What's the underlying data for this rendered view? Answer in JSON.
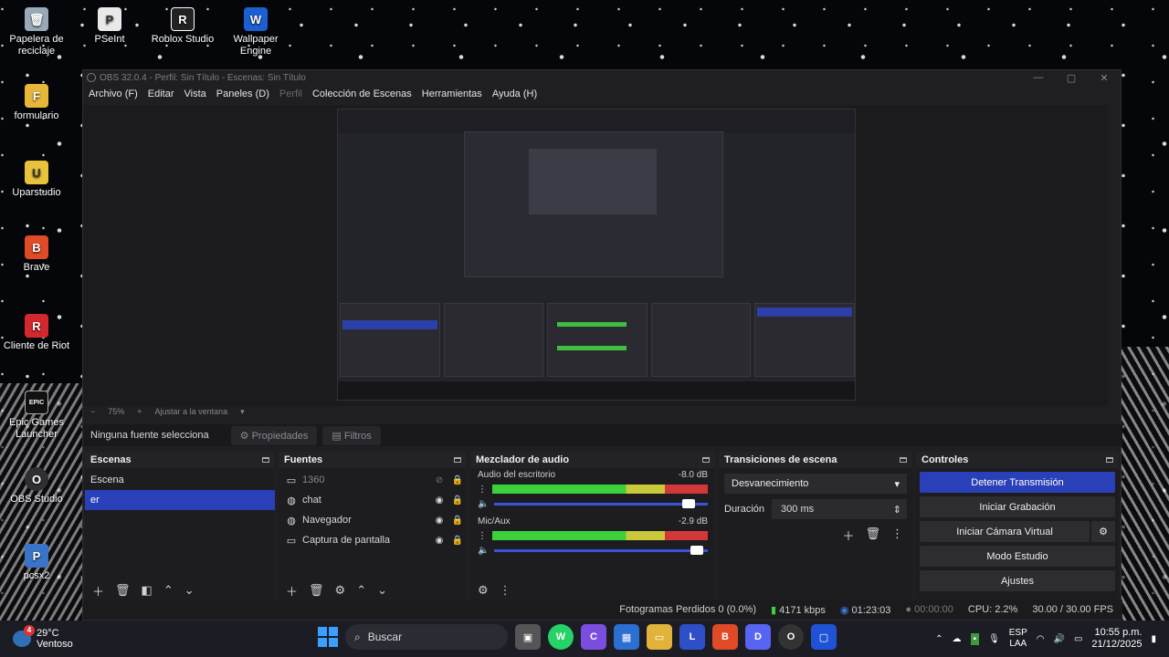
{
  "desktop": {
    "icons": [
      {
        "label": "Papelera de reciclaje",
        "glyph": "🗑"
      },
      {
        "label": "PSeInt",
        "glyph": "P"
      },
      {
        "label": "Roblox Studio",
        "glyph": "R"
      },
      {
        "label": "Wallpaper Engine",
        "glyph": "W"
      },
      {
        "label": "formulario",
        "glyph": "F"
      },
      {
        "label": "Uparstudio",
        "glyph": "U"
      },
      {
        "label": "Brave",
        "glyph": "B"
      },
      {
        "label": "Cliente de Riot",
        "glyph": "R"
      },
      {
        "label": "Epic Games Launcher",
        "glyph": "EPIC"
      },
      {
        "label": "OBS Studio",
        "glyph": "O"
      },
      {
        "label": "pcsx2",
        "glyph": "P"
      }
    ]
  },
  "window": {
    "title": "OBS 32.0.4 - Perfil: Sin Título - Escenas: Sin Título",
    "controls": {
      "minimize": "—",
      "maximize": "▢",
      "close": "✕"
    },
    "menu": [
      "Archivo (F)",
      "Editar",
      "Vista",
      "Paneles (D)",
      "Perfil",
      "Colección de Escenas",
      "Herramientas",
      "Ayuda (H)"
    ]
  },
  "zoom": {
    "minus": "−",
    "value": "75%",
    "plus": "+",
    "fit": "Ajustar a la ventana",
    "caret": "▾"
  },
  "source_bar": {
    "status": "Ninguna fuente selecciona",
    "properties": "Propiedades",
    "filters": "Filtros"
  },
  "scenes": {
    "title": "Escenas",
    "items": [
      "Escena",
      "er"
    ],
    "selected": 1
  },
  "sources": {
    "title": "Fuentes",
    "items": [
      {
        "name": "1360",
        "icon": "monitor",
        "hidden": true
      },
      {
        "name": "chat",
        "icon": "browser",
        "hidden": false
      },
      {
        "name": "Navegador",
        "icon": "browser",
        "hidden": false
      },
      {
        "name": "Captura de pantalla",
        "icon": "monitor",
        "hidden": false
      }
    ]
  },
  "mixer": {
    "title": "Mezclador de audio",
    "channels": [
      {
        "name": "Audio del escritorio",
        "db": "-8.0 dB",
        "volume": 0.9
      },
      {
        "name": "Mic/Aux",
        "db": "-2.9 dB",
        "volume": 0.98
      }
    ],
    "scale": [
      "-60",
      "-55",
      "-50",
      "-45",
      "-40",
      "-35",
      "-30",
      "-25",
      "-20",
      "-15",
      "-10",
      "-5",
      "0"
    ]
  },
  "transitions": {
    "title": "Transiciones de escena",
    "selected": "Desvanecimiento",
    "duration_label": "Duración",
    "duration_value": "300 ms"
  },
  "controls": {
    "title": "Controles",
    "stop_stream": "Detener Transmisión",
    "start_recording": "Iniciar Grabación",
    "start_virtual_cam": "Iniciar Cámara Virtual",
    "studio_mode": "Modo Estudio",
    "settings": "Ajustes"
  },
  "status": {
    "dropped": "Fotogramas Perdidos 0 (0.0%)",
    "bitrate": "4171 kbps",
    "live_time": "01:23:03",
    "rec_time": "00:00:00",
    "cpu": "CPU: 2.2%",
    "fps": "30.00 / 30.00 FPS"
  },
  "taskbar": {
    "temp": "29°C",
    "weather": "Ventoso",
    "weather_badge": "4",
    "search": "Buscar",
    "lang": "ESP",
    "region": "LAA",
    "time": "10:55 p.m.",
    "date": "21/12/2025"
  }
}
